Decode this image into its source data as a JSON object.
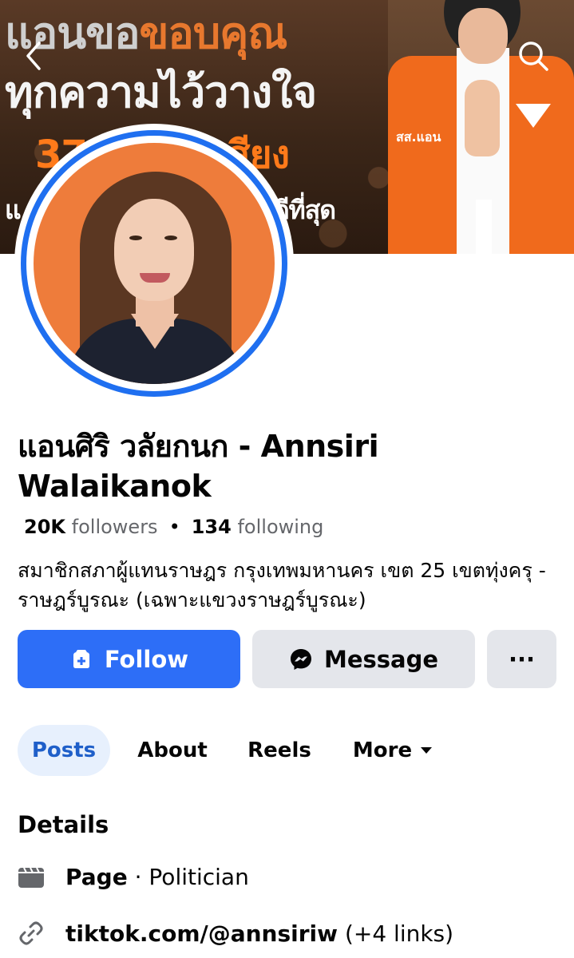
{
  "cover": {
    "line1_a": "แอนขอ",
    "line1_b": "ขอบคุณ",
    "line2": "ทุกความไว้วางใจ",
    "line3_a": "37",
    "line3_b": "เสียง",
    "line4_a": "แ",
    "line4_b": "ร้ดีที่สุด",
    "vest_text": "สส.แอน",
    "accent_color": "#f06a1c"
  },
  "nav": {
    "back_icon": "chevron-left-icon",
    "search_icon": "search-icon"
  },
  "profile": {
    "name": "แอนศิริ วลัยกนก - Annsiri Walaikanok",
    "followers_count": "20K",
    "followers_label": "followers",
    "separator": "•",
    "following_count": "134",
    "following_label": "following",
    "bio": "สมาชิกสภาผู้แทนราษฎร กรุงเทพมหานคร เขต 25 เขตทุ่งครุ - ราษฎร์บูรณะ (เฉพาะแขวงราษฎร์บูรณะ)"
  },
  "actions": {
    "follow_label": "Follow",
    "message_label": "Message",
    "more_label": "···",
    "follow_color": "#2d6ef7"
  },
  "tabs": [
    {
      "label": "Posts",
      "active": true
    },
    {
      "label": "About",
      "active": false
    },
    {
      "label": "Reels",
      "active": false
    },
    {
      "label": "More",
      "active": false
    }
  ],
  "details": {
    "title": "Details",
    "page_label": "Page",
    "page_sep": "·",
    "page_category": "Politician",
    "link_label": "tiktok.com/@annsiriw",
    "link_extra": "(+4 links)"
  }
}
